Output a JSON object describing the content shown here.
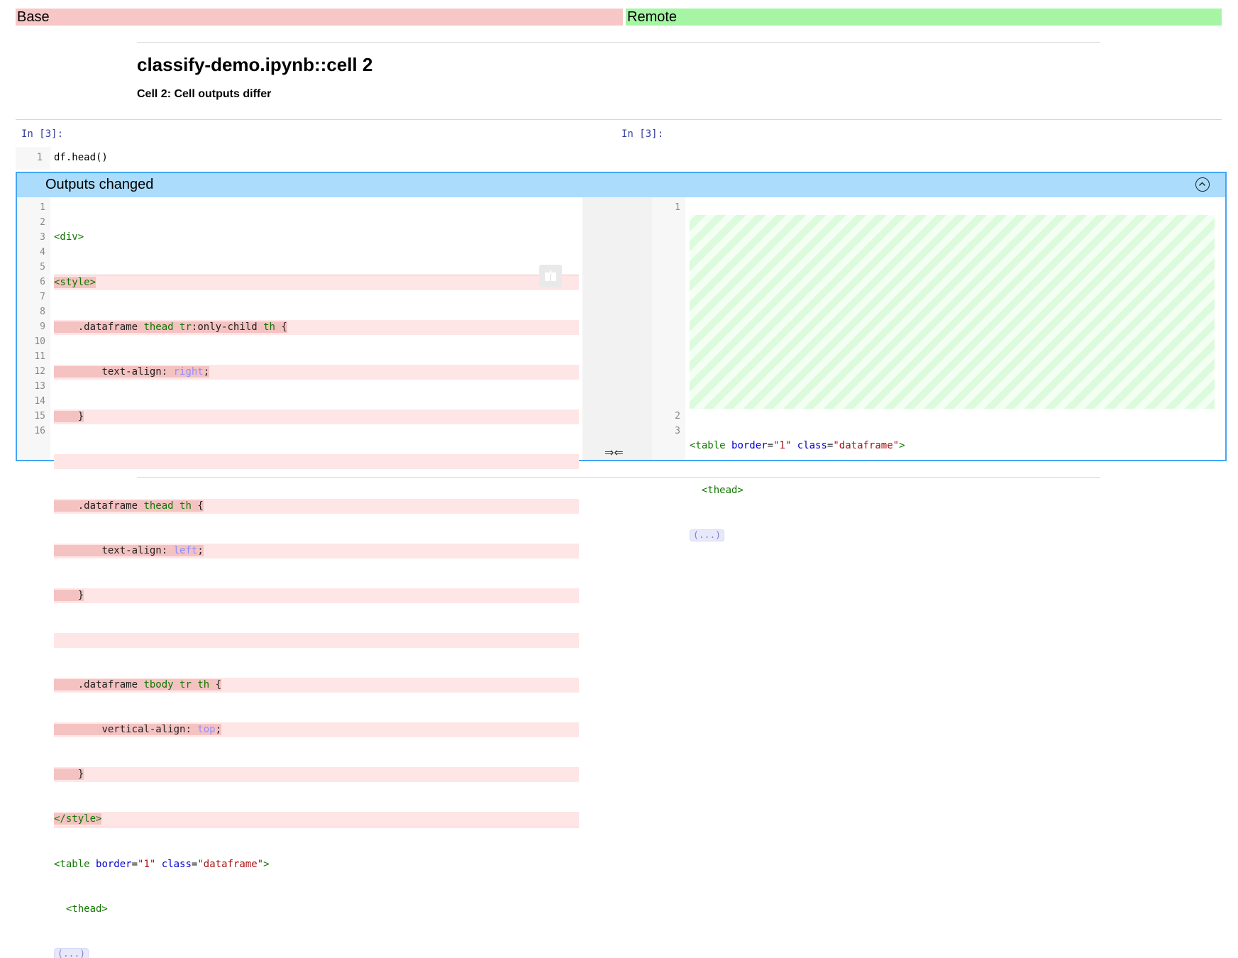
{
  "headers": {
    "base": "Base",
    "remote": "Remote"
  },
  "cell": {
    "title": "classify-demo.ipynb::cell 2",
    "subtitle": "Cell 2: Cell outputs differ",
    "prompt_base": "In [3]:",
    "prompt_remote": "In [3]:",
    "source_line_no": "1",
    "source": "df.head()"
  },
  "outputs": {
    "label": "Outputs changed",
    "merge_arrows": "⇒⇐",
    "ellipsis": "(...)",
    "base_line_numbers": [
      "1",
      "2",
      "3",
      "4",
      "5",
      "6",
      "7",
      "8",
      "9",
      "10",
      "11",
      "12",
      "13",
      "14",
      "15",
      "16"
    ],
    "remote_line_numbers": [
      "1",
      "2",
      "3"
    ],
    "code": {
      "div_open": "<div>",
      "style_open": "<style>",
      "style_close": "</style>",
      "df_class": ".dataframe",
      "thead": "thead",
      "tbody": "tbody",
      "tr": "tr",
      "only_child": ":only-child",
      "th": "th",
      "brace_open": " {",
      "brace_close": "}",
      "text_align": "text-align:",
      "vertical_align": "vertical-align:",
      "right": "right",
      "left": "left",
      "top": "top",
      "semicolon": ";",
      "table_tag": "<table",
      "border_attr": "border",
      "border_val": "\"1\"",
      "class_attr": "class",
      "class_val": "\"dataframe\"",
      "eq": "=",
      "gt": ">",
      "thead_tag": "<thead>"
    }
  },
  "colors": {
    "base_header": "#f7c7c7",
    "remote_header": "#a5f5a5",
    "outputs_border": "#42a5f5",
    "outputs_bar": "#abdcfc"
  },
  "icons": {
    "collapse": "chevron-up-circle-icon",
    "copy": "copy-icon"
  }
}
